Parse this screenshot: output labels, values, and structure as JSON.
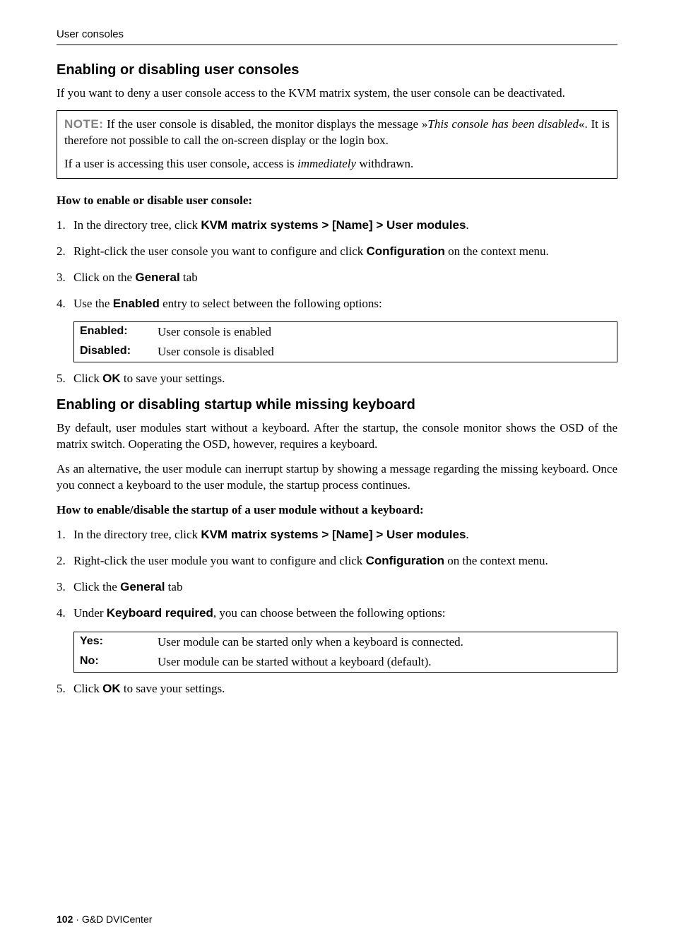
{
  "header": {
    "running": "User consoles"
  },
  "s1": {
    "heading": "Enabling or disabling user consoles",
    "intro": "If you want to deny a user console access to the KVM matrix system, the user console can be deactivated.",
    "note": {
      "label": "NOTE:",
      "part1a": " If the user console is disabled, the monitor displays the message »",
      "part1b": "This console has been disabled",
      "part1c": "«. It is therefore not possible to call the on-screen display or the login box.",
      "part2a": "If a user is accessing this user console, access is ",
      "part2b": "immediately",
      "part2c": " withdrawn."
    },
    "howto": "How to enable or disable user console:",
    "steps": {
      "s1a": "In the directory tree, click ",
      "s1b": "KVM matrix systems > [Name] > User modules",
      "s1c": ".",
      "s2a": "Right-click the user console you want to configure and click ",
      "s2b": "Configuration",
      "s2c": " on the context menu.",
      "s3a": "Click on the ",
      "s3b": "General",
      "s3c": " tab",
      "s4a": "Use the ",
      "s4b": "Enabled",
      "s4c": " entry to select between the following options:",
      "s5a": "Click ",
      "s5b": "OK",
      "s5c": " to save your settings."
    },
    "options": {
      "k1": "Enabled:",
      "v1": "User console is enabled",
      "k2": "Disabled:",
      "v2": "User console is disabled"
    }
  },
  "s2": {
    "heading": "Enabling or disabling startup while missing keyboard",
    "p1": "By default, user modules start without a keyboard. After the startup, the console monitor shows the OSD of the matrix switch. Ooperating the OSD, however, requires a keyboard.",
    "p2": "As an alternative, the user module can inerrupt startup by showing a message regarding the missing keyboard. Once you connect a keyboard to the user module, the startup process continues.",
    "howto": "How to enable/disable the startup of a user module without a keyboard:",
    "steps": {
      "s1a": "In the directory tree, click ",
      "s1b": "KVM matrix systems > [Name] > User modules",
      "s1c": ".",
      "s2a": "Right-click the user module you want to configure and click ",
      "s2b": "Configuration",
      "s2c": " on the context menu.",
      "s3a": "Click the ",
      "s3b": "General",
      "s3c": " tab",
      "s4a": "Under ",
      "s4b": "Keyboard required",
      "s4c": ", you can choose between the following options:",
      "s5a": "Click ",
      "s5b": "OK",
      "s5c": " to save your settings."
    },
    "options": {
      "k1": "Yes:",
      "v1": "User module can be started only when a keyboard is connected.",
      "k2": "No:",
      "v2": "User module can be started without a keyboard (default)."
    }
  },
  "footer": {
    "page": "102",
    "sep": " · ",
    "product": "G&D DVICenter"
  }
}
